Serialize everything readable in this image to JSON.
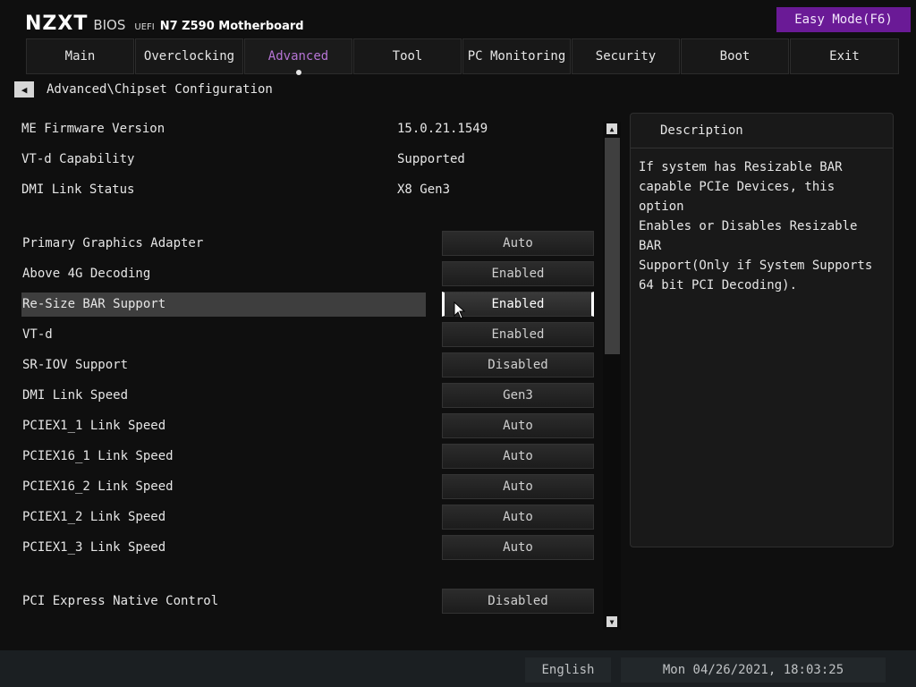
{
  "header": {
    "logo": "NZXT",
    "bios": "BIOS",
    "uefi": "UEFI",
    "board": "N7 Z590 Motherboard",
    "easy_mode": "Easy Mode(F6)"
  },
  "tabs": [
    {
      "label": "Main"
    },
    {
      "label": "Overclocking"
    },
    {
      "label": "Advanced",
      "active": true
    },
    {
      "label": "Tool"
    },
    {
      "label": "PC Monitoring"
    },
    {
      "label": "Security"
    },
    {
      "label": "Boot"
    },
    {
      "label": "Exit"
    }
  ],
  "breadcrumb": {
    "back_icon": "triangle-left-icon",
    "path": "Advanced\\Chipset Configuration"
  },
  "info": [
    {
      "label": "ME Firmware Version",
      "value": "15.0.21.1549"
    },
    {
      "label": "VT-d Capability",
      "value": "Supported"
    },
    {
      "label": "DMI Link Status",
      "value": "X8  Gen3"
    }
  ],
  "settings": [
    {
      "label": "Primary Graphics Adapter",
      "value": "Auto"
    },
    {
      "label": "Above 4G Decoding",
      "value": "Enabled"
    },
    {
      "label": "Re-Size BAR Support",
      "value": "Enabled",
      "selected": true
    },
    {
      "label": "VT-d",
      "value": "Enabled"
    },
    {
      "label": "SR-IOV Support",
      "value": "Disabled"
    },
    {
      "label": "DMI Link Speed",
      "value": "Gen3"
    },
    {
      "label": "PCIEX1_1 Link Speed",
      "value": "Auto"
    },
    {
      "label": "PCIEX16_1 Link Speed",
      "value": "Auto"
    },
    {
      "label": "PCIEX16_2 Link Speed",
      "value": "Auto"
    },
    {
      "label": "PCIEX1_2 Link Speed",
      "value": "Auto"
    },
    {
      "label": "PCIEX1_3 Link Speed",
      "value": "Auto"
    },
    {
      "label": "PCI Express Native Control",
      "value": "Disabled"
    }
  ],
  "description": {
    "title": "Description",
    "lines": [
      "If system has Resizable BAR",
      "capable PCIe Devices, this option",
      "Enables or Disables Resizable BAR",
      "Support(Only if System Supports",
      "64 bit PCI Decoding)."
    ]
  },
  "status": {
    "language": "English",
    "datetime": "Mon 04/26/2021, 18:03:25"
  },
  "colors": {
    "accent": "#6a1a96",
    "active_tab_text": "#b574d4",
    "background": "#0f0f0f"
  }
}
